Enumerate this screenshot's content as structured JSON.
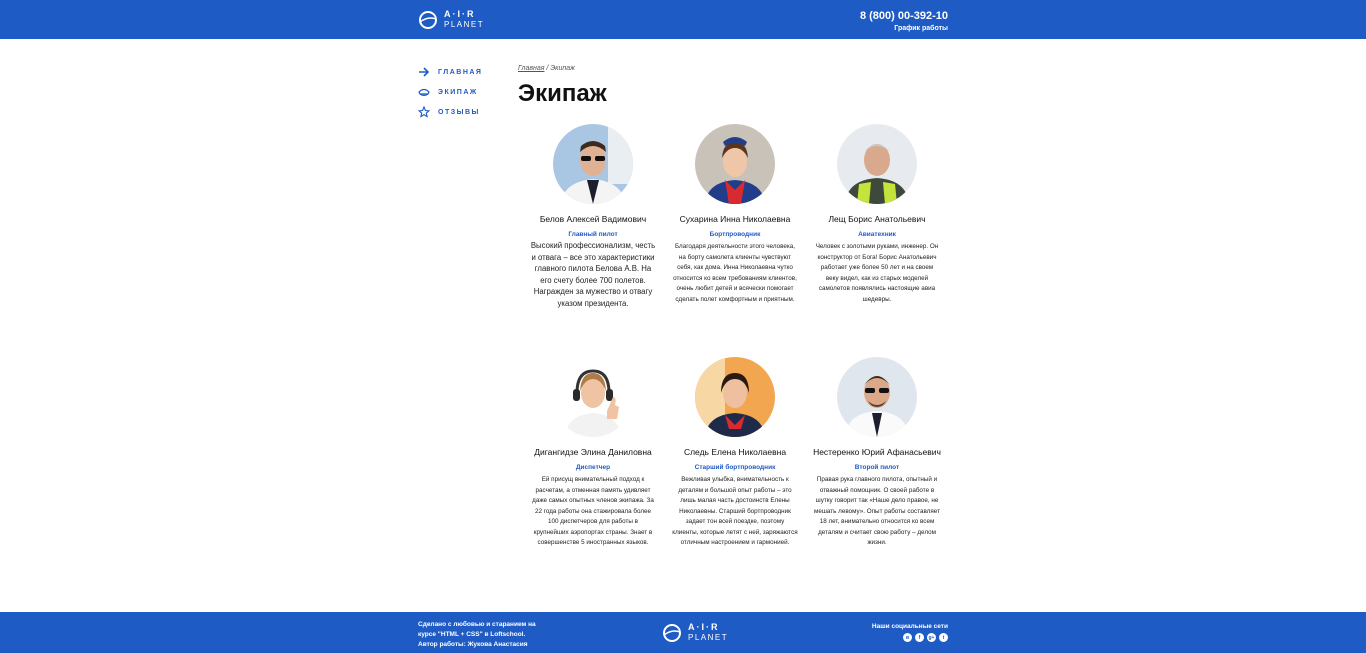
{
  "brand": {
    "line1": "A·I·R",
    "line2": "PLANET"
  },
  "header": {
    "phone": "8 (800) 00-392-10",
    "schedule": "График работы"
  },
  "nav": [
    {
      "label": "ГЛАВНАЯ",
      "icon": "arrow-right-icon"
    },
    {
      "label": "ЭКИПАЖ",
      "icon": "pilot-cap-icon"
    },
    {
      "label": "ОТЗЫВЫ",
      "icon": "star-icon"
    }
  ],
  "breadcrumb": {
    "home": "Главная",
    "sep": " / ",
    "current": "Экипаж"
  },
  "page_title": "Экипаж",
  "crew": [
    {
      "name": "Белов Алексей Вадимович",
      "role": "Главный пилот",
      "desc": "Высокий профессионализм, честь и отвага – все это характеристики главного пилота Белова А.В. На его счету более 700 полетов. Награжден за мужество и отвагу указом президента."
    },
    {
      "name": "Сухарина Инна Николаевна",
      "role": "Бортпроводник",
      "desc": "Благодаря деятельности этого человека, на борту самолета клиенты чувствуют себя, как дома. Инна Николаевна чутко относится ко всем требованиям клиентов, очень любит детей и всячески помогает сделать полет комфортным и приятным."
    },
    {
      "name": "Лещ Борис Анатольевич",
      "role": "Авиатехник",
      "desc": "Человек с золотыми руками, инженер. Он конструктор от Бога! Борис Анатольевич работает уже более 50 лет и на своем веку видел, как из старых моделей самолетов появлялись настоящие авиа шедевры."
    },
    {
      "name": "Дигангидзе Элина Даниловна",
      "role": "Диспетчер",
      "desc": "Ей присущ внимательный подход к расчетам, а отменная память удивляет даже самых опытных членов экипажа. За 22 года работы она стажировала более 100 диспетчеров для работы в крупнейших аэропортах страны. Знает в совершенстве 5 иностранных языков."
    },
    {
      "name": "Следь Елена Николаевна",
      "role": "Старший бортпроводник",
      "desc": "Вежливая улыбка, внимательность к деталям и большой опыт работы – это лишь малая часть достоинств Елены Николаевны. Старший бортпроводник задает тон всей поездке, поэтому клиенты, которые летят с ней, заряжаются отличным настроением и гармонией."
    },
    {
      "name": "Нестеренко Юрий Афанасьевич",
      "role": "Второй пилот",
      "desc": "Правая рука главного пилота, опытный и отважный помощник. О своей работе в шутку говорит так «Наше дело правое, не мешать левому». Опыт работы составляет 18 лет, внимательно относится ко всем деталям и считает свою работу – делом жизни."
    }
  ],
  "footer": {
    "credit_line1": "Сделано с любовью и старанием на",
    "credit_line2": "курсе \"HTML + CSS\" в Loftschool.",
    "credit_line3": "Автор работы: Жукова Анастасия",
    "social_title": "Наши социальные сети",
    "social": [
      {
        "icon": "vk-icon",
        "glyph": "в"
      },
      {
        "icon": "facebook-icon",
        "glyph": "f"
      },
      {
        "icon": "google-plus-icon",
        "glyph": "g+"
      },
      {
        "icon": "twitter-icon",
        "glyph": "t"
      }
    ]
  },
  "colors": {
    "primary": "#1f5bc4",
    "text": "#111111",
    "background": "#ffffff"
  }
}
